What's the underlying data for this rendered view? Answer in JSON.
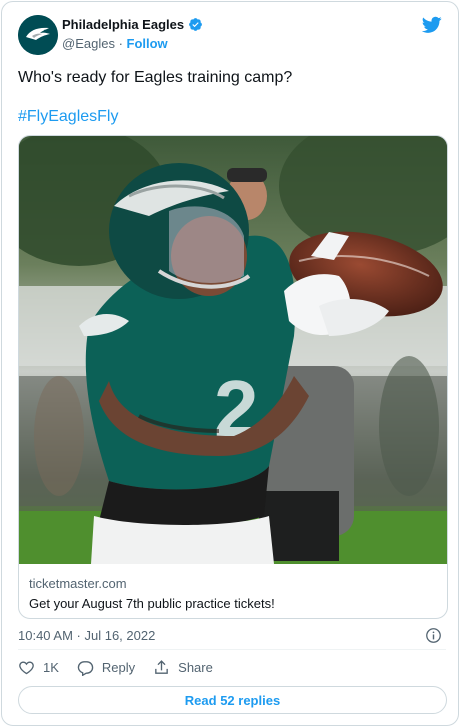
{
  "tweet": {
    "author_name": "Philadelphia Eagles",
    "handle": "@Eagles",
    "separator": " · ",
    "follow_label": "Follow",
    "text": "Who's ready for Eagles training camp?",
    "hashtag": "#FlyEaglesFly",
    "timestamp": "10:40 AM · Jul 16, 2022"
  },
  "link_card": {
    "domain": "ticketmaster.com",
    "title": "Get your August 7th public practice tickets!",
    "image_icon": "football-player-photo"
  },
  "actions": {
    "like_count": "1K",
    "reply_label": "Reply",
    "share_label": "Share",
    "read_replies_label": "Read 52 replies"
  },
  "icons": {
    "verified": "verified-badge-icon",
    "twitter": "twitter-bird-icon",
    "info": "info-icon",
    "like": "heart-icon",
    "reply": "reply-icon",
    "share": "share-icon"
  },
  "colors": {
    "accent": "#1d9bf0",
    "text": "#0f1419",
    "secondary": "#536471",
    "border": "#cfd9de",
    "eagles_green": "#004c54"
  }
}
